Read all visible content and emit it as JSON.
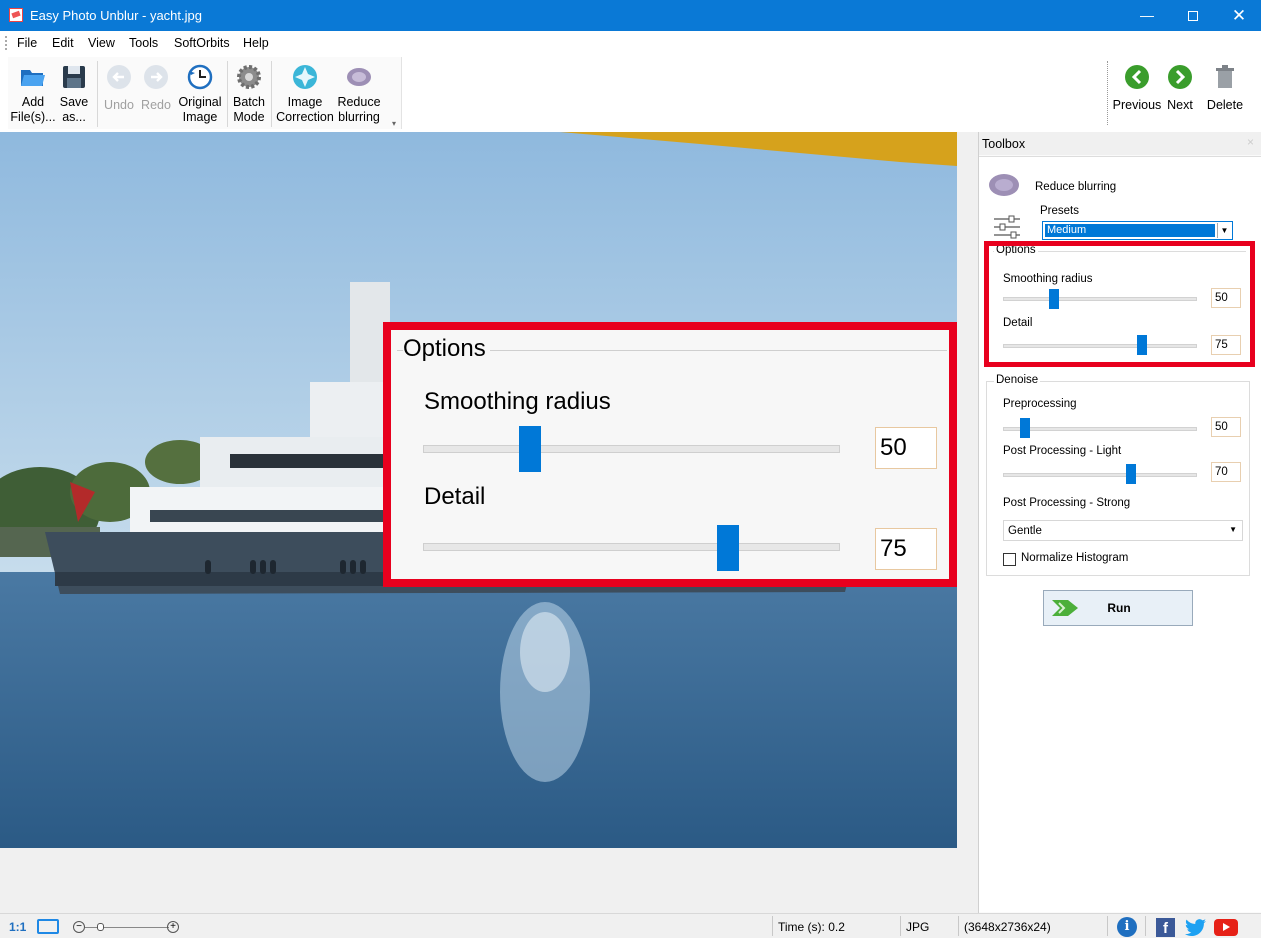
{
  "window": {
    "title": "Easy Photo Unblur - yacht.jpg",
    "minimize": "—",
    "close": "✕"
  },
  "menu": [
    "File",
    "Edit",
    "View",
    "Tools",
    "SoftOrbits",
    "Help"
  ],
  "toolbar": {
    "add_files": "Add\nFile(s)...",
    "save_as": "Save\nas...",
    "undo": "Undo",
    "redo": "Redo",
    "original_image": "Original\nImage",
    "batch_mode": "Batch\nMode",
    "image_correction": "Image\nCorrection",
    "reduce_blurring": "Reduce\nblurring",
    "previous": "Previous",
    "next": "Next",
    "delete": "Delete"
  },
  "callout": {
    "legend": "Options",
    "smoothing_label": "Smoothing radius",
    "smoothing_value": "50",
    "detail_label": "Detail",
    "detail_value": "75"
  },
  "toolbox": {
    "title": "Toolbox",
    "close": "×",
    "tool_name": "Reduce blurring",
    "presets_label": "Presets",
    "preset_value": "Medium",
    "options": {
      "title": "Options",
      "smoothing_label": "Smoothing radius",
      "smoothing_value": "50",
      "smoothing_level": 0.25,
      "detail_label": "Detail",
      "detail_value": "75",
      "detail_level": 0.73
    },
    "denoise": {
      "title": "Denoise",
      "pre_label": "Preprocessing",
      "pre_value": "50",
      "pre_level": 0.09,
      "post_light_label": "Post Processing - Light",
      "post_light_value": "70",
      "post_light_level": 0.67,
      "post_strong_label": "Post Processing - Strong",
      "post_strong_value": "Gentle",
      "normalize_label": "Normalize Histogram",
      "normalize_checked": false
    },
    "run_label": "Run"
  },
  "status": {
    "zoom_ratio": "1:1",
    "time": "Time (s): 0.2",
    "format": "JPG",
    "dimensions": "(3648x2736x24)"
  },
  "colors": {
    "accent": "#0078d7",
    "highlight_border": "#e8001e",
    "titlebar": "#0a79d6"
  }
}
